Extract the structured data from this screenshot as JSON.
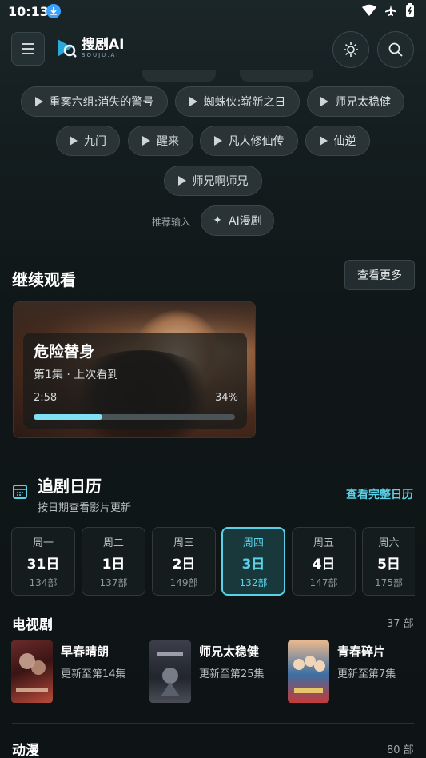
{
  "status": {
    "time": "10:13"
  },
  "app": {
    "name": "搜剧AI",
    "sub": "SOUJU.AI"
  },
  "hot_searches": [
    {
      "label": "重案六组:消失的警号"
    },
    {
      "label": "蜘蛛侠:崭新之日"
    },
    {
      "label": "师兄太稳健"
    },
    {
      "label": "九门"
    },
    {
      "label": "醒来"
    },
    {
      "label": "凡人修仙传"
    },
    {
      "label": "仙逆"
    },
    {
      "label": "师兄啊师兄"
    }
  ],
  "recommend": {
    "label": "推荐输入",
    "chip": "AI漫剧"
  },
  "continue": {
    "title": "继续观看",
    "more": "查看更多",
    "card": {
      "title": "危险替身",
      "subtitle": "第1集 · 上次看到",
      "time": "2:58",
      "percent_label": "34%",
      "progress": 0.34
    }
  },
  "calendar": {
    "title": "追剧日历",
    "subtitle": "按日期查看影片更新",
    "link": "查看完整日历",
    "days": [
      {
        "weekday": "周一",
        "date": "31日",
        "count": "134部"
      },
      {
        "weekday": "周二",
        "date": "1日",
        "count": "137部"
      },
      {
        "weekday": "周三",
        "date": "2日",
        "count": "149部"
      },
      {
        "weekday": "周四",
        "date": "3日",
        "count": "132部"
      },
      {
        "weekday": "周五",
        "date": "4日",
        "count": "147部"
      },
      {
        "weekday": "周六",
        "date": "5日",
        "count": "175部"
      }
    ]
  },
  "tv": {
    "title": "电视剧",
    "count": "37 部",
    "items": [
      {
        "name": "早春晴朗",
        "update": "更新至第14集"
      },
      {
        "name": "师兄太稳健",
        "update": "更新至第25集"
      },
      {
        "name": "青春碎片",
        "update": "更新至第7集"
      }
    ]
  },
  "anime": {
    "title": "动漫",
    "count": "80 部"
  },
  "colors": {
    "accent": "#5ad1e6",
    "background": "#121a1b"
  }
}
